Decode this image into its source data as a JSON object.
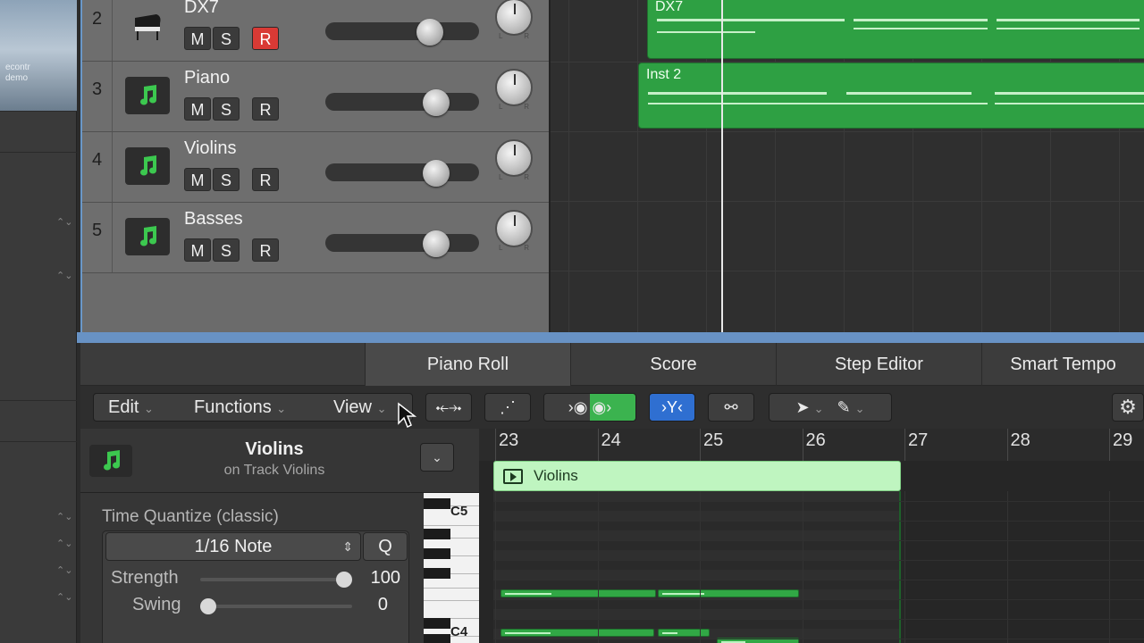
{
  "sidebar": {
    "thumbnail_text": [
      "econtr",
      "demo"
    ]
  },
  "tracks": [
    {
      "number": "2",
      "name": "DX7",
      "icon": "grand-piano-icon",
      "mute": "M",
      "solo": "S",
      "record": "R",
      "record_armed": true,
      "volume_fraction": 0.68
    },
    {
      "number": "3",
      "name": "Piano",
      "icon": "music-note-icon",
      "mute": "M",
      "solo": "S",
      "record": "R",
      "record_armed": false,
      "volume_fraction": 0.72
    },
    {
      "number": "4",
      "name": "Violins",
      "icon": "music-note-icon",
      "mute": "M",
      "solo": "S",
      "record": "R",
      "record_armed": false,
      "volume_fraction": 0.72
    },
    {
      "number": "5",
      "name": "Basses",
      "icon": "music-note-icon",
      "mute": "M",
      "solo": "S",
      "record": "R",
      "record_armed": false,
      "volume_fraction": 0.72
    }
  ],
  "pan": {
    "left": "L",
    "right": "R"
  },
  "arrange": {
    "regions": [
      {
        "name": "DX7",
        "track": "2"
      },
      {
        "name": "Inst 2",
        "track": "3"
      }
    ]
  },
  "editor_tabs": [
    {
      "label": "Piano Roll",
      "active": true
    },
    {
      "label": "Score",
      "active": false
    },
    {
      "label": "Step Editor",
      "active": false
    },
    {
      "label": "Smart Tempo",
      "active": false
    }
  ],
  "toolbar": {
    "edit": "Edit",
    "functions": "Functions",
    "view": "View"
  },
  "region_header": {
    "title": "Violins",
    "subtitle": "on Track Violins"
  },
  "quantize": {
    "title": "Time Quantize (classic)",
    "value": "1/16 Note",
    "q_label": "Q",
    "strength_label": "Strength",
    "strength_value": "100",
    "strength_fraction": 1.0,
    "swing_label": "Swing",
    "swing_value": "0",
    "swing_fraction": 0.0
  },
  "keyboard": {
    "c5": "C5",
    "c4": "C4"
  },
  "piano_roll": {
    "bars": [
      "23",
      "24",
      "25",
      "26",
      "27",
      "28",
      "29"
    ],
    "region_name": "Violins"
  },
  "colors": {
    "region_green": "#2ea043",
    "record_red": "#d93a35",
    "selection_blue": "#6892c4"
  }
}
